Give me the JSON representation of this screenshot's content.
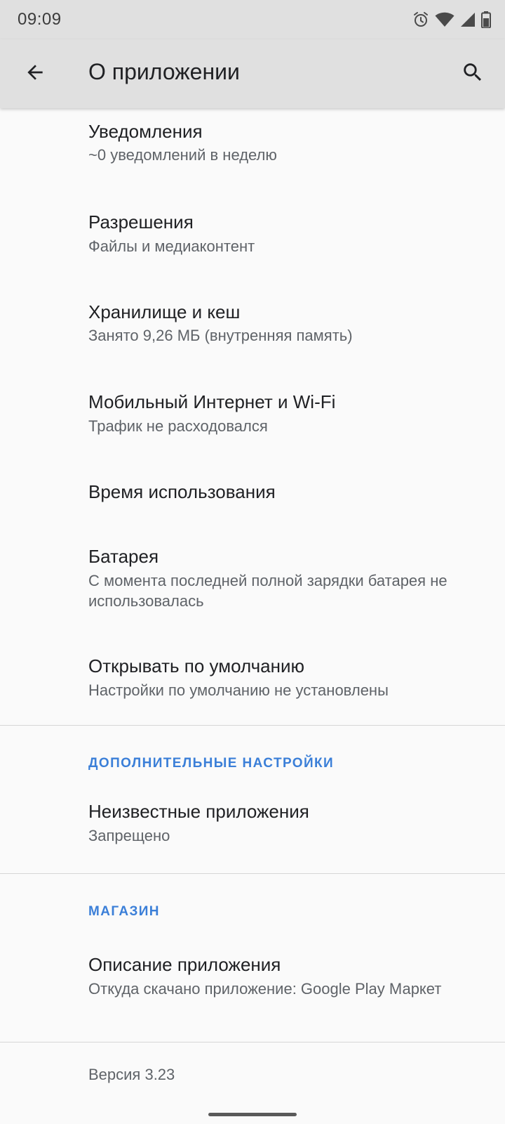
{
  "status_bar": {
    "time": "09:09",
    "icons": [
      "alarm-icon",
      "wifi-icon",
      "cellular-signal-icon",
      "battery-icon"
    ]
  },
  "app_bar": {
    "title": "О приложении",
    "back_icon": "arrow-back-icon",
    "search_icon": "search-icon"
  },
  "items": [
    {
      "title": "Уведомления",
      "subtitle": "~0 уведомлений в неделю"
    },
    {
      "title": "Разрешения",
      "subtitle": "Файлы и медиаконтент"
    },
    {
      "title": "Хранилище и кеш",
      "subtitle": "Занято 9,26 МБ (внутренняя память)"
    },
    {
      "title": "Мобильный Интернет и Wi-Fi",
      "subtitle": "Трафик не расходовался"
    },
    {
      "title": "Время использования"
    },
    {
      "title": "Батарея",
      "subtitle": "С момента последней полной зарядки батарея не использовалась"
    },
    {
      "title": "Открывать по умолчанию",
      "subtitle": "Настройки по умолчанию не установлены"
    }
  ],
  "sections": {
    "advanced": {
      "header": "ДОПОЛНИТЕЛЬНЫЕ НАСТРОЙКИ",
      "items": [
        {
          "title": "Неизвестные приложения",
          "subtitle": "Запрещено"
        }
      ]
    },
    "store": {
      "header": "МАГАЗИН",
      "items": [
        {
          "title": "Описание приложения",
          "subtitle": "Откуда скачано приложение: Google Play Маркет"
        }
      ]
    }
  },
  "version": "Версия 3.23",
  "colors": {
    "accent": "#3b7fd8",
    "app_bar_bg": "#e0e0e0",
    "background": "#fafafa",
    "primary_text": "#202124",
    "secondary_text": "#5f6368"
  }
}
